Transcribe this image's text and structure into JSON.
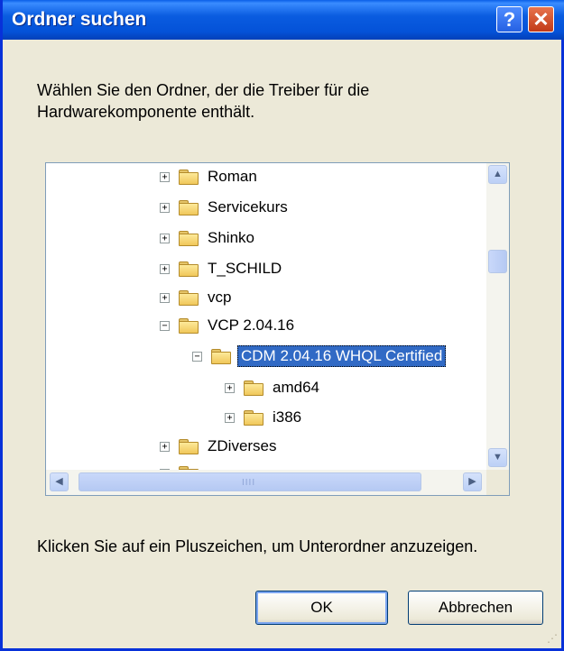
{
  "window": {
    "title": "Ordner suchen",
    "help_label": "?",
    "close_label": "✕"
  },
  "description": "Wählen Sie den Ordner, der die Treiber für die Hardwarekomponente enthält.",
  "tree": {
    "items": [
      {
        "label": "Roman",
        "expander": "+"
      },
      {
        "label": "Servicekurs",
        "expander": "+"
      },
      {
        "label": "Shinko",
        "expander": "+"
      },
      {
        "label": "T_SCHILD",
        "expander": "+"
      },
      {
        "label": "vcp",
        "expander": "+"
      },
      {
        "label": "VCP 2.04.16",
        "expander": "−"
      },
      {
        "label": "CDM 2.04.16 WHQL Certified",
        "expander": "−",
        "selected": true
      },
      {
        "label": "amd64",
        "expander": "+"
      },
      {
        "label": "i386",
        "expander": "+"
      },
      {
        "label": "ZDiverses",
        "expander": "+"
      }
    ]
  },
  "hint": "Klicken Sie auf ein Pluszeichen, um Unterordner anzuzeigen.",
  "buttons": {
    "ok": "OK",
    "cancel": "Abbrechen"
  },
  "scroll_icons": {
    "up": "▲",
    "down": "▼",
    "left": "◀",
    "right": "▶",
    "grip": "IIII"
  }
}
